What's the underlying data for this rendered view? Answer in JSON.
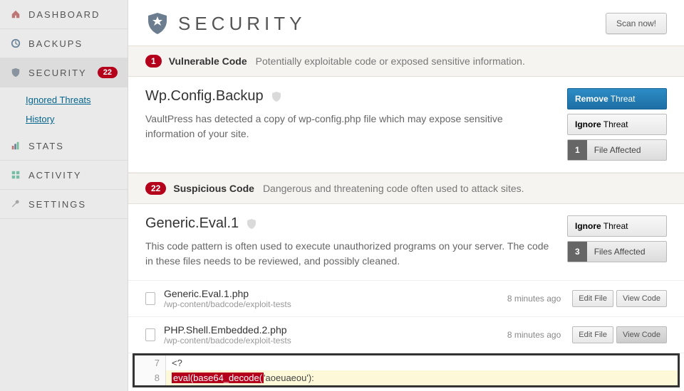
{
  "sidebar": {
    "items": [
      {
        "label": "DASHBOARD",
        "icon": "home"
      },
      {
        "label": "BACKUPS",
        "icon": "clock"
      },
      {
        "label": "SECURITY",
        "icon": "shield",
        "badge": "22",
        "active": true
      },
      {
        "label": "STATS",
        "icon": "chart"
      },
      {
        "label": "ACTIVITY",
        "icon": "grid"
      },
      {
        "label": "SETTINGS",
        "icon": "wrench"
      }
    ],
    "sub": [
      {
        "label": "Ignored Threats"
      },
      {
        "label": "History"
      }
    ]
  },
  "header": {
    "title": "SECURITY",
    "scan_label": "Scan now!"
  },
  "sections": [
    {
      "count": "1",
      "title": "Vulnerable Code",
      "desc": "Potentially exploitable code or exposed sensitive information."
    },
    {
      "count": "22",
      "title": "Suspicious Code",
      "desc": "Dangerous and threatening code often used to attack sites."
    }
  ],
  "threats": [
    {
      "title": "Wp.Config.Backup",
      "desc": "VaultPress has detected a copy of wp-config.php file which may expose sensitive information of your site.",
      "actions": {
        "remove_b": "Remove",
        "remove_t": " Threat",
        "ignore_b": "Ignore",
        "ignore_t": " Threat",
        "count": "1",
        "count_label": "File Affected"
      }
    },
    {
      "title": "Generic.Eval.1",
      "desc": "This code pattern is often used to execute unauthorized programs on your server. The code in these files needs to be reviewed, and possibly cleaned.",
      "actions": {
        "ignore_b": "Ignore",
        "ignore_t": " Threat",
        "count": "3",
        "count_label": "Files Affected"
      }
    }
  ],
  "files": [
    {
      "name": "Generic.Eval.1.php",
      "path": "/wp-content/badcode/exploit-tests",
      "time": "8 minutes ago",
      "edit": "Edit File",
      "view": "View Code"
    },
    {
      "name": "PHP.Shell.Embedded.2.php",
      "path": "/wp-content/badcode/exploit-tests",
      "time": "8 minutes ago",
      "edit": "Edit File",
      "view": "View Code"
    }
  ],
  "code": {
    "lines": [
      {
        "n": "7",
        "text": "<?"
      },
      {
        "n": "8",
        "hl": "eval(base64_decode(",
        "rest": "'aoeuaeou'):"
      }
    ]
  }
}
